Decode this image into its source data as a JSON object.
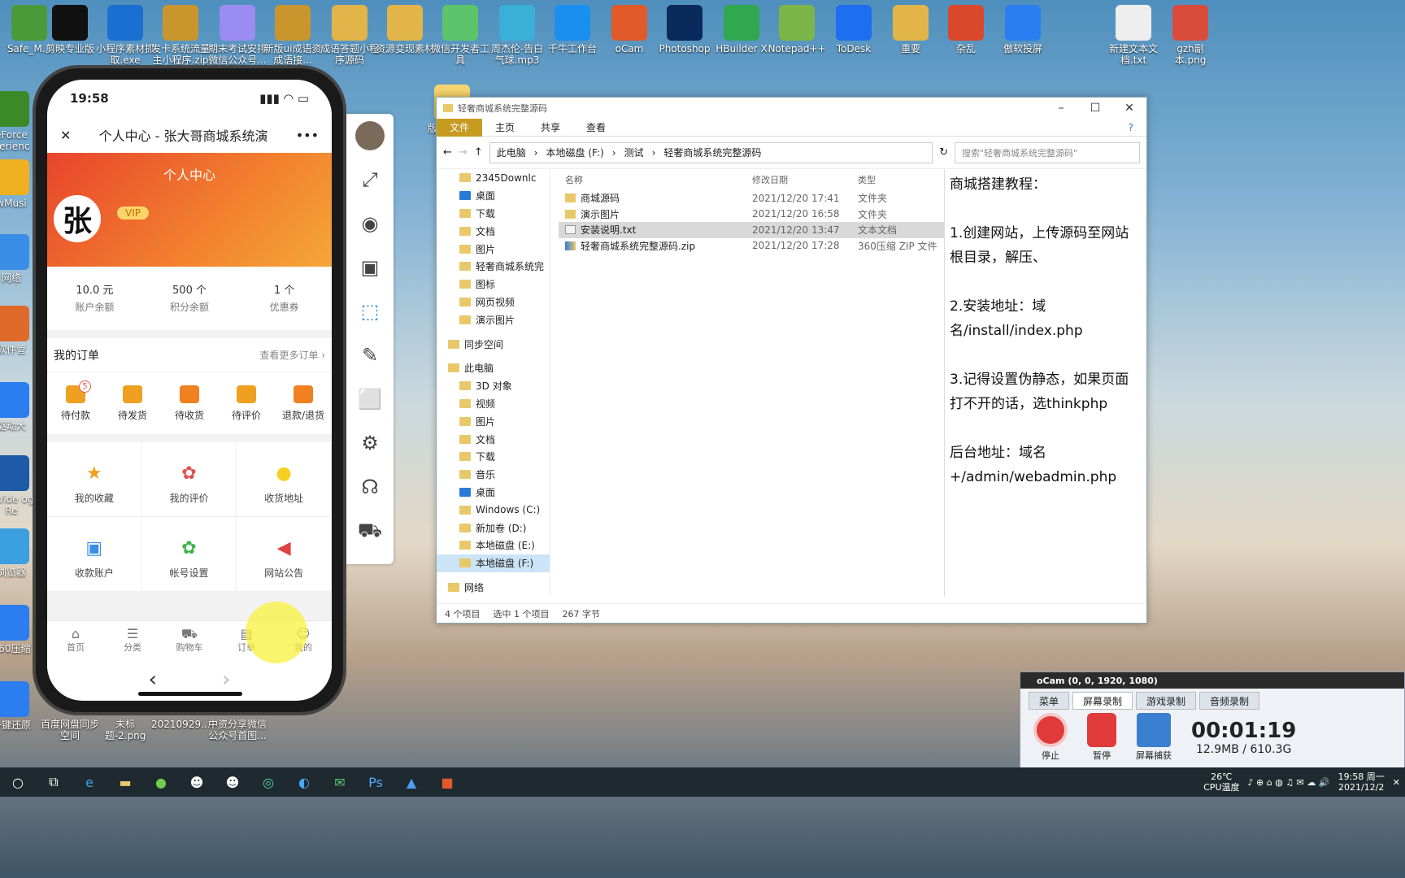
{
  "desktop": {
    "icons": [
      {
        "label": "Safe_M...",
        "color": "#4a9a3a"
      },
      {
        "label": "剪映专业版",
        "color": "#111"
      },
      {
        "label": "小程序素材抓取.exe",
        "color": "#1a6fd1"
      },
      {
        "label": "发卡系统流量主小程序.zip",
        "color": "#c9962e"
      },
      {
        "label": "期末考试安排微信公众号...",
        "color": "#9a8cf0"
      },
      {
        "label": "新版ui成语资成语接...",
        "color": "#c9962e"
      },
      {
        "label": "成语答题小程序源码",
        "color": "#e2b54a"
      },
      {
        "label": "资源变现素材",
        "color": "#e2b54a"
      },
      {
        "label": "微信开发者工具",
        "color": "#5cc56b"
      },
      {
        "label": "周杰伦-告白气球.mp3",
        "color": "#3ab0d9"
      },
      {
        "label": "千牛工作台",
        "color": "#1a8ff0"
      },
      {
        "label": "oCam",
        "color": "#e05a2a"
      },
      {
        "label": "Photoshop",
        "color": "#0a2a5c"
      },
      {
        "label": "HBuilder X",
        "color": "#2fa84f"
      },
      {
        "label": "Notepad++",
        "color": "#7bb547"
      },
      {
        "label": "ToDesk",
        "color": "#1e6ff0"
      },
      {
        "label": "重要",
        "color": "#e2b54a"
      },
      {
        "label": "杂乱",
        "color": "#d9482b"
      },
      {
        "label": "傲软投屏",
        "color": "#2b7df0"
      },
      {
        "label": "新建文本文档.txt",
        "color": "#eeeeee"
      },
      {
        "label": "gzh副本.png",
        "color": "#d94c3c"
      }
    ],
    "left_icons": [
      "eForce perienc",
      "wMusi",
      "网络",
      "软件管",
      "驱动大",
      "sy Vide ogo Re",
      "浏览器",
      "360压缩",
      "一键还原"
    ],
    "bottom_icons": [
      "百度网盘同步空间",
      "未标题-2.png",
      "20210929...",
      "中资分享微信公众号首图..."
    ],
    "mid_icons": [
      "版UI成语小程序..."
    ]
  },
  "phone": {
    "time": "19:58",
    "nav_title": "个人中心 - 张大哥商城系统演",
    "close": "✕",
    "more": "•••",
    "hero_title": "个人中心",
    "avatar_char": "张",
    "vip": "VIP",
    "stats": [
      {
        "value": "10.0 元",
        "label": "账户余额"
      },
      {
        "value": "500 个",
        "label": "积分余额"
      },
      {
        "value": "1 个",
        "label": "优惠券"
      }
    ],
    "orders_title": "我的订单",
    "orders_more": "查看更多订单 ›",
    "orders": [
      {
        "label": "待付款",
        "badge": "5",
        "color": "#f0a020"
      },
      {
        "label": "待发货",
        "color": "#f0a020"
      },
      {
        "label": "待收货",
        "color": "#f08020"
      },
      {
        "label": "待评价",
        "color": "#f0a020"
      },
      {
        "label": "退款/退货",
        "color": "#f08020"
      }
    ],
    "grid": [
      {
        "label": "我的收藏",
        "icon": "★",
        "color": "#f0a020"
      },
      {
        "label": "我的评价",
        "icon": "✿",
        "color": "#e05050"
      },
      {
        "label": "收货地址",
        "icon": "●",
        "color": "#f5d020"
      },
      {
        "label": "收款账户",
        "icon": "▣",
        "color": "#3a8ee6"
      },
      {
        "label": "帐号设置",
        "icon": "✿",
        "color": "#3bb54a"
      },
      {
        "label": "网站公告",
        "icon": "◀",
        "color": "#e04040"
      }
    ],
    "tabs": [
      {
        "label": "首页",
        "icon": "⌂"
      },
      {
        "label": "分类",
        "icon": "☰"
      },
      {
        "label": "购物车",
        "icon": "⛟"
      },
      {
        "label": "订单",
        "icon": "▤"
      },
      {
        "label": "我的",
        "icon": "☺"
      }
    ],
    "back": "‹",
    "forward": "›"
  },
  "explorer": {
    "title": "轻奢商城系统完整源码",
    "ribbon": [
      "文件",
      "主页",
      "共享",
      "查看"
    ],
    "path": [
      "此电脑",
      "本地磁盘 (F:)",
      "测试",
      "轻奢商城系统完整源码"
    ],
    "search_placeholder": "搜索\"轻奢商城系统完整源码\"",
    "nav": [
      {
        "label": "2345Downlc"
      },
      {
        "label": "桌面"
      },
      {
        "label": "下载"
      },
      {
        "label": "文档"
      },
      {
        "label": "图片"
      },
      {
        "label": "轻奢商城系统完"
      },
      {
        "label": "图标"
      },
      {
        "label": "网页视频"
      },
      {
        "label": "演示图片"
      },
      {
        "label": "同步空间"
      },
      {
        "label": "此电脑"
      },
      {
        "label": "3D 对象"
      },
      {
        "label": "视频"
      },
      {
        "label": "图片"
      },
      {
        "label": "文档"
      },
      {
        "label": "下载"
      },
      {
        "label": "音乐"
      },
      {
        "label": "桌面"
      },
      {
        "label": "Windows (C:)"
      },
      {
        "label": "新加卷 (D:)"
      },
      {
        "label": "本地磁盘 (E:)"
      },
      {
        "label": "本地磁盘 (F:)"
      },
      {
        "label": "网络"
      }
    ],
    "headers": [
      "名称",
      "修改日期",
      "类型"
    ],
    "files": [
      {
        "name": "商城源码",
        "date": "2021/12/20 17:41",
        "type": "文件夹"
      },
      {
        "name": "演示图片",
        "date": "2021/12/20 16:58",
        "type": "文件夹"
      },
      {
        "name": "安装说明.txt",
        "date": "2021/12/20 13:47",
        "type": "文本文档"
      },
      {
        "name": "轻奢商城系统完整源码.zip",
        "date": "2021/12/20 17:28",
        "type": "360压缩 ZIP 文件"
      }
    ],
    "preview": [
      "商城搭建教程：",
      "1.创建网站，上传源码至网站根目录，解压、",
      "2.安装地址：域名/install/index.php",
      "3.记得设置伪静态，如果页面打不开的话，选thinkphp",
      "后台地址：域名+/admin/webadmin.php"
    ],
    "status": [
      "4 个项目",
      "选中 1 个项目",
      "267 字节"
    ]
  },
  "ocam": {
    "title": "oCam (0, 0, 1920, 1080)",
    "tabs": [
      "菜单",
      "屏幕录制",
      "游戏录制",
      "音频录制"
    ],
    "buttons": [
      "停止",
      "暂停",
      "屏幕捕获"
    ],
    "timer": "00:01:19",
    "size": "12.9MB / 610.3G"
  },
  "taskbar": {
    "temp": "26℃",
    "temp_label": "CPU温度",
    "time": "19:58 周一",
    "date": "2021/12/2"
  }
}
